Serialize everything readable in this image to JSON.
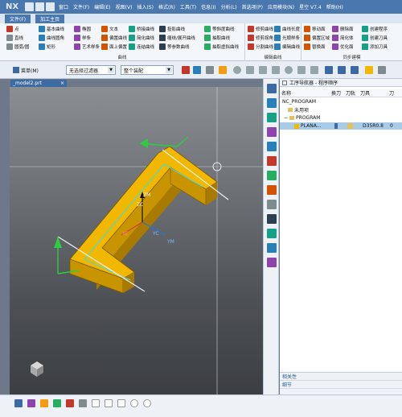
{
  "app": {
    "logo": "NX",
    "menu": [
      "窗口",
      "文件(F)",
      "编辑(E)",
      "视图(V)",
      "插入(S)",
      "格式(R)",
      "工具(T)",
      "信息(I)",
      "分析(L)",
      "首选项(P)",
      "应用模块(N)",
      "星空 V7.4",
      "帮助(H)"
    ]
  },
  "ribbon": {
    "tabs": [
      "文件(F)",
      "加工主页"
    ],
    "groups": [
      {
        "label": "曲线",
        "items": [
          "点",
          "直线",
          "圆弧/圆",
          "基本曲线",
          "曲线圆角",
          "矩形",
          "椭圆",
          "样条",
          "艺术样条",
          "文本",
          "偏置曲线",
          "面上偏置",
          "桥接曲线",
          "简化曲线",
          "连结曲线",
          "投影曲线",
          "缠绕/展开曲线",
          "等参数曲线",
          "等斜度曲线",
          "抽取曲线",
          "抽取虚拟曲线"
        ]
      },
      {
        "label": "编辑曲线",
        "items": [
          "修剪曲线",
          "修剪拐角",
          "分割曲线",
          "曲线长度",
          "光顺样条",
          "编辑曲线"
        ]
      },
      {
        "label": "同步建模",
        "items": [
          "移动面",
          "偏置区域",
          "替换面",
          "删除面",
          "简化体",
          "优化面",
          "创建程序",
          "创建刀具",
          "添加刀具"
        ]
      }
    ]
  },
  "selection_bar": {
    "menu_label": "菜单(M)",
    "filter_value": "无选择过滤器",
    "assembly_value": "整个装配"
  },
  "document": {
    "tab_label": "_model2.prt"
  },
  "viewport": {
    "axis_labels": {
      "zm": "ZM",
      "zc": "ZC",
      "xc": "XC",
      "ym": "YM",
      "yc": "YC"
    },
    "colors": {
      "part": "#f2b800",
      "part_dark": "#c89400",
      "arrow_green": "#2ecc40",
      "arrow_white": "#f0f0f0",
      "path_cyan": "#4fd8d8"
    }
  },
  "navigator": {
    "title": "工序导航器 - 程序顺序",
    "columns": [
      "名称",
      "换刀",
      "刀轨",
      "刀具",
      "刀"
    ],
    "rows": [
      {
        "name": "NC_PROGRAM",
        "level": 0
      },
      {
        "name": "未用项",
        "level": 1
      },
      {
        "name": "PROGRAM",
        "level": 1
      },
      {
        "name": "PLANA...",
        "level": 2,
        "tool": "D35R0.8",
        "extra": "0",
        "selected": true
      }
    ],
    "bottom_panels": [
      "相关性",
      "细节"
    ]
  }
}
